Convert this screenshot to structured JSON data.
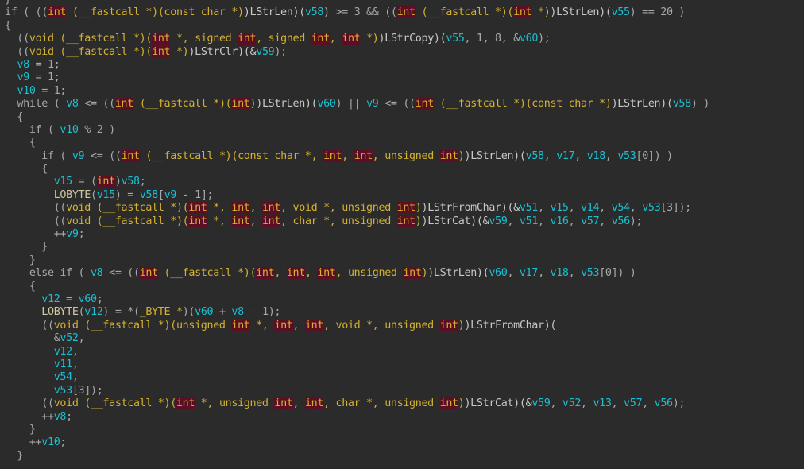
{
  "view": "pseudocode-editor",
  "colors": {
    "background": "#2b2b2b",
    "plain": "#a9a9a9",
    "type": "#d4b130",
    "keyword_highlight_bg": "#5c0f22",
    "variable": "#19c0d2"
  },
  "lines": [
    [
      [
        "p",
        "}"
      ]
    ],
    [
      [
        "p",
        "if ( (("
      ],
      [
        "k",
        "int"
      ],
      [
        "t",
        " (__fastcall *)(const char *)"
      ],
      [
        "f",
        ")LStrLen)("
      ],
      [
        "v",
        "v58"
      ],
      [
        "p",
        ") >= 3 && (("
      ],
      [
        "k",
        "int"
      ],
      [
        "t",
        " (__fastcall *)("
      ],
      [
        "k",
        "int"
      ],
      [
        "t",
        " *)"
      ],
      [
        "f",
        ")LStrLen)("
      ],
      [
        "v",
        "v55"
      ],
      [
        "p",
        ") == 20 )"
      ]
    ],
    [
      [
        "p",
        "{"
      ]
    ],
    [
      [
        "p",
        "  (("
      ],
      [
        "t",
        "void (__fastcall *)("
      ],
      [
        "k",
        "int"
      ],
      [
        "t",
        " *, signed "
      ],
      [
        "k",
        "int"
      ],
      [
        "t",
        ", signed "
      ],
      [
        "k",
        "int"
      ],
      [
        "t",
        ", "
      ],
      [
        "k",
        "int"
      ],
      [
        "t",
        " *)"
      ],
      [
        "f",
        ")LStrCopy)("
      ],
      [
        "v",
        "v55"
      ],
      [
        "p",
        ", 1, 8, &"
      ],
      [
        "v",
        "v60"
      ],
      [
        "p",
        ");"
      ]
    ],
    [
      [
        "p",
        "  (("
      ],
      [
        "t",
        "void (__fastcall *)("
      ],
      [
        "k",
        "int"
      ],
      [
        "t",
        " *)"
      ],
      [
        "f",
        ")LStrClr)(&"
      ],
      [
        "v",
        "v59"
      ],
      [
        "p",
        ");"
      ]
    ],
    [
      [
        "p",
        "  "
      ],
      [
        "v",
        "v8"
      ],
      [
        "p",
        " = 1;"
      ]
    ],
    [
      [
        "p",
        "  "
      ],
      [
        "v",
        "v9"
      ],
      [
        "p",
        " = 1;"
      ]
    ],
    [
      [
        "p",
        "  "
      ],
      [
        "v",
        "v10"
      ],
      [
        "p",
        " = 1;"
      ]
    ],
    [
      [
        "p",
        "  while ( "
      ],
      [
        "v",
        "v8"
      ],
      [
        "p",
        " <= (("
      ],
      [
        "k",
        "int"
      ],
      [
        "t",
        " (__fastcall *)("
      ],
      [
        "k",
        "int"
      ],
      [
        "t",
        ")"
      ],
      [
        "f",
        ")LStrLen)("
      ],
      [
        "v",
        "v60"
      ],
      [
        "p",
        ") || "
      ],
      [
        "v",
        "v9"
      ],
      [
        "p",
        " <= (("
      ],
      [
        "k",
        "int"
      ],
      [
        "t",
        " (__fastcall *)(const char *)"
      ],
      [
        "f",
        ")LStrLen)("
      ],
      [
        "v",
        "v58"
      ],
      [
        "p",
        ") )"
      ]
    ],
    [
      [
        "p",
        "  {"
      ]
    ],
    [
      [
        "p",
        "    if ( "
      ],
      [
        "v",
        "v10"
      ],
      [
        "p",
        " % 2 )"
      ]
    ],
    [
      [
        "p",
        "    {"
      ]
    ],
    [
      [
        "p",
        "      if ( "
      ],
      [
        "v",
        "v9"
      ],
      [
        "p",
        " <= (("
      ],
      [
        "k",
        "int"
      ],
      [
        "t",
        " (__fastcall *)(const char *, "
      ],
      [
        "k",
        "int"
      ],
      [
        "t",
        ", "
      ],
      [
        "k",
        "int"
      ],
      [
        "t",
        ", unsigned "
      ],
      [
        "k",
        "int"
      ],
      [
        "t",
        ")"
      ],
      [
        "f",
        ")LStrLen)("
      ],
      [
        "v",
        "v58"
      ],
      [
        "p",
        ", "
      ],
      [
        "v",
        "v17"
      ],
      [
        "p",
        ", "
      ],
      [
        "v",
        "v18"
      ],
      [
        "p",
        ", "
      ],
      [
        "v",
        "v53"
      ],
      [
        "p",
        "[0]) )"
      ]
    ],
    [
      [
        "p",
        "      {"
      ]
    ],
    [
      [
        "p",
        "        "
      ],
      [
        "v",
        "v15"
      ],
      [
        "p",
        " = ("
      ],
      [
        "k",
        "int"
      ],
      [
        "p",
        ")"
      ],
      [
        "v",
        "v58"
      ],
      [
        "p",
        ";"
      ]
    ],
    [
      [
        "p",
        "        "
      ],
      [
        "m",
        "LOBYTE"
      ],
      [
        "p",
        "("
      ],
      [
        "v",
        "v15"
      ],
      [
        "p",
        ") = "
      ],
      [
        "v",
        "v58"
      ],
      [
        "p",
        "["
      ],
      [
        "v",
        "v9"
      ],
      [
        "p",
        " - 1];"
      ]
    ],
    [
      [
        "p",
        "        (("
      ],
      [
        "t",
        "void (__fastcall *)("
      ],
      [
        "k",
        "int"
      ],
      [
        "t",
        " *, "
      ],
      [
        "k",
        "int"
      ],
      [
        "t",
        ", "
      ],
      [
        "k",
        "int"
      ],
      [
        "t",
        ", void *, unsigned "
      ],
      [
        "k",
        "int"
      ],
      [
        "t",
        ")"
      ],
      [
        "f",
        ")LStrFromChar)(&"
      ],
      [
        "v",
        "v51"
      ],
      [
        "p",
        ", "
      ],
      [
        "v",
        "v15"
      ],
      [
        "p",
        ", "
      ],
      [
        "v",
        "v14"
      ],
      [
        "p",
        ", "
      ],
      [
        "v",
        "v54"
      ],
      [
        "p",
        ", "
      ],
      [
        "v",
        "v53"
      ],
      [
        "p",
        "[3]);"
      ]
    ],
    [
      [
        "p",
        "        (("
      ],
      [
        "t",
        "void (__fastcall *)("
      ],
      [
        "k",
        "int"
      ],
      [
        "t",
        " *, "
      ],
      [
        "k",
        "int"
      ],
      [
        "t",
        ", "
      ],
      [
        "k",
        "int"
      ],
      [
        "t",
        ", char *, unsigned "
      ],
      [
        "k",
        "int"
      ],
      [
        "t",
        ")"
      ],
      [
        "f",
        ")LStrCat)(&"
      ],
      [
        "v",
        "v59"
      ],
      [
        "p",
        ", "
      ],
      [
        "v",
        "v51"
      ],
      [
        "p",
        ", "
      ],
      [
        "v",
        "v16"
      ],
      [
        "p",
        ", "
      ],
      [
        "v",
        "v57"
      ],
      [
        "p",
        ", "
      ],
      [
        "v",
        "v56"
      ],
      [
        "p",
        ");"
      ]
    ],
    [
      [
        "p",
        "        ++"
      ],
      [
        "v",
        "v9"
      ],
      [
        "p",
        ";"
      ]
    ],
    [
      [
        "p",
        "      }"
      ]
    ],
    [
      [
        "p",
        "    }"
      ]
    ],
    [
      [
        "p",
        "    else if ( "
      ],
      [
        "v",
        "v8"
      ],
      [
        "p",
        " <= (("
      ],
      [
        "k",
        "int"
      ],
      [
        "t",
        " (__fastcall *)("
      ],
      [
        "k",
        "int"
      ],
      [
        "t",
        ", "
      ],
      [
        "k",
        "int"
      ],
      [
        "t",
        ", "
      ],
      [
        "k",
        "int"
      ],
      [
        "t",
        ", unsigned "
      ],
      [
        "k",
        "int"
      ],
      [
        "t",
        ")"
      ],
      [
        "f",
        ")LStrLen)("
      ],
      [
        "v",
        "v60"
      ],
      [
        "p",
        ", "
      ],
      [
        "v",
        "v17"
      ],
      [
        "p",
        ", "
      ],
      [
        "v",
        "v18"
      ],
      [
        "p",
        ", "
      ],
      [
        "v",
        "v53"
      ],
      [
        "p",
        "[0]) )"
      ]
    ],
    [
      [
        "p",
        "    {"
      ]
    ],
    [
      [
        "p",
        "      "
      ],
      [
        "v",
        "v12"
      ],
      [
        "p",
        " = "
      ],
      [
        "v",
        "v60"
      ],
      [
        "p",
        ";"
      ]
    ],
    [
      [
        "p",
        "      "
      ],
      [
        "m",
        "LOBYTE"
      ],
      [
        "p",
        "("
      ],
      [
        "v",
        "v12"
      ],
      [
        "p",
        ") = *("
      ],
      [
        "t",
        "_BYTE *"
      ],
      [
        "p",
        ")("
      ],
      [
        "v",
        "v60"
      ],
      [
        "p",
        " + "
      ],
      [
        "v",
        "v8"
      ],
      [
        "p",
        " - 1);"
      ]
    ],
    [
      [
        "p",
        "      (("
      ],
      [
        "t",
        "void (__fastcall *)(unsigned "
      ],
      [
        "k",
        "int"
      ],
      [
        "t",
        " *, "
      ],
      [
        "k",
        "int"
      ],
      [
        "t",
        ", "
      ],
      [
        "k",
        "int"
      ],
      [
        "t",
        ", void *, unsigned "
      ],
      [
        "k",
        "int"
      ],
      [
        "t",
        ")"
      ],
      [
        "f",
        ")LStrFromChar)("
      ]
    ],
    [
      [
        "p",
        "        &"
      ],
      [
        "v",
        "v52"
      ],
      [
        "p",
        ","
      ]
    ],
    [
      [
        "p",
        "        "
      ],
      [
        "v",
        "v12"
      ],
      [
        "p",
        ","
      ]
    ],
    [
      [
        "p",
        "        "
      ],
      [
        "v",
        "v11"
      ],
      [
        "p",
        ","
      ]
    ],
    [
      [
        "p",
        "        "
      ],
      [
        "v",
        "v54"
      ],
      [
        "p",
        ","
      ]
    ],
    [
      [
        "p",
        "        "
      ],
      [
        "v",
        "v53"
      ],
      [
        "p",
        "[3]);"
      ]
    ],
    [
      [
        "p",
        "      (("
      ],
      [
        "t",
        "void (__fastcall *)("
      ],
      [
        "k",
        "int"
      ],
      [
        "t",
        " *, unsigned "
      ],
      [
        "k",
        "int"
      ],
      [
        "t",
        ", "
      ],
      [
        "k",
        "int"
      ],
      [
        "t",
        ", char *, unsigned "
      ],
      [
        "k",
        "int"
      ],
      [
        "t",
        ")"
      ],
      [
        "f",
        ")LStrCat)(&"
      ],
      [
        "v",
        "v59"
      ],
      [
        "p",
        ", "
      ],
      [
        "v",
        "v52"
      ],
      [
        "p",
        ", "
      ],
      [
        "v",
        "v13"
      ],
      [
        "p",
        ", "
      ],
      [
        "v",
        "v57"
      ],
      [
        "p",
        ", "
      ],
      [
        "v",
        "v56"
      ],
      [
        "p",
        ");"
      ]
    ],
    [
      [
        "p",
        "      ++"
      ],
      [
        "v",
        "v8"
      ],
      [
        "p",
        ";"
      ]
    ],
    [
      [
        "p",
        "    }"
      ]
    ],
    [
      [
        "p",
        "    ++"
      ],
      [
        "v",
        "v10"
      ],
      [
        "p",
        ";"
      ]
    ],
    [
      [
        "p",
        "  }"
      ]
    ]
  ]
}
